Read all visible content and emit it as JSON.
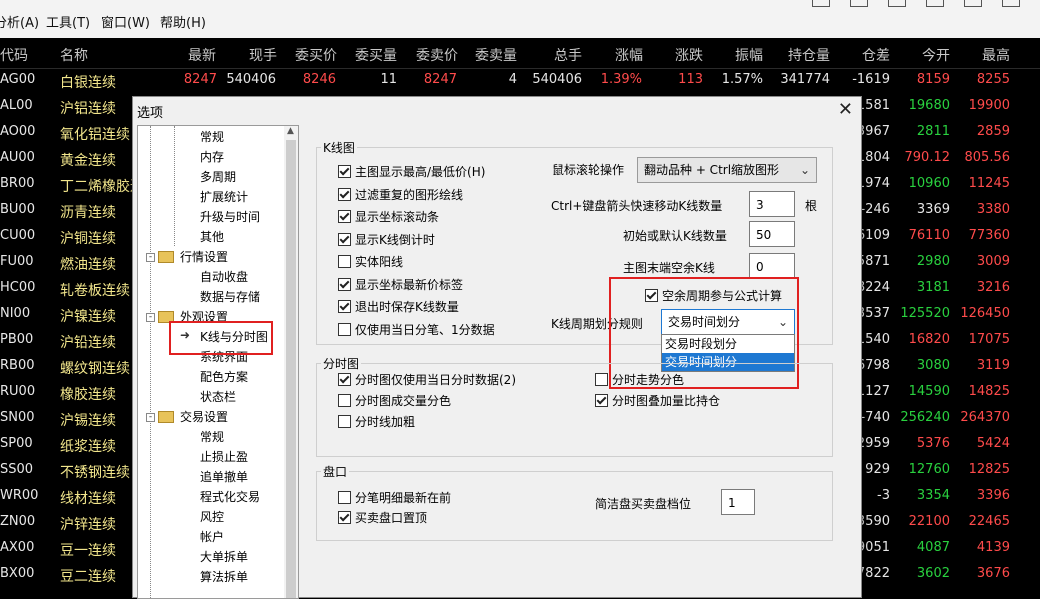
{
  "menu": [
    "分析(A)",
    "工具(T)",
    "窗口(W)",
    "帮助(H)"
  ],
  "columns": [
    "代码",
    "名称",
    "最新",
    "现手",
    "委买价",
    "委买量",
    "委卖价",
    "委卖量",
    "总手",
    "涨幅",
    "涨跌",
    "振幅",
    "持仓量",
    "仓差",
    "今开",
    "最高"
  ],
  "rows": [
    {
      "code": "AG00",
      "name": "白银连续",
      "c": [
        "8247",
        "540406",
        "8246",
        "11",
        "8247",
        "4",
        "540406",
        "1.39%",
        "113",
        "1.57%",
        "341774",
        "-1619",
        "8159",
        "8255"
      ],
      "k": [
        "red",
        "wht",
        "red",
        "wht",
        "red",
        "wht",
        "wht",
        "red",
        "red",
        "wht",
        "wht",
        "wht",
        "red",
        "red"
      ]
    },
    {
      "code": "AL00",
      "name": "沪铝连续",
      "c": [
        "",
        "",
        "",
        "",
        "",
        "",
        "",
        "",
        "",
        "",
        "",
        "1581",
        "19680",
        "19900"
      ],
      "k": [
        "",
        "",
        "",
        "",
        "",
        "",
        "",
        "",
        "",
        "",
        "",
        "wht",
        "grn",
        "red"
      ]
    },
    {
      "code": "AO00",
      "name": "氧化铝连续",
      "c": [
        "",
        "",
        "",
        "",
        "",
        "",
        "",
        "",
        "",
        "",
        "",
        "3967",
        "2811",
        "2859"
      ],
      "k": [
        "",
        "",
        "",
        "",
        "",
        "",
        "",
        "",
        "",
        "",
        "",
        "wht",
        "grn",
        "red"
      ]
    },
    {
      "code": "AU00",
      "name": "黄金连续",
      "c": [
        "",
        "",
        "",
        "",
        "",
        "",
        "",
        "",
        "",
        "",
        "",
        "1804",
        "790.12",
        "805.56"
      ],
      "k": [
        "",
        "",
        "",
        "",
        "",
        "",
        "",
        "",
        "",
        "",
        "",
        "wht",
        "red",
        "red"
      ]
    },
    {
      "code": "BR00",
      "name": "丁二烯橡胶连",
      "c": [
        "",
        "",
        "",
        "",
        "",
        "",
        "",
        "",
        "",
        "",
        "",
        "1974",
        "10960",
        "11245"
      ],
      "k": [
        "",
        "",
        "",
        "",
        "",
        "",
        "",
        "",
        "",
        "",
        "",
        "wht",
        "grn",
        "red"
      ]
    },
    {
      "code": "BU00",
      "name": "沥青连续",
      "c": [
        "",
        "",
        "",
        "",
        "",
        "",
        "",
        "",
        "",
        "",
        "",
        "-246",
        "3369",
        "3380"
      ],
      "k": [
        "",
        "",
        "",
        "",
        "",
        "",
        "",
        "",
        "",
        "",
        "",
        "wht",
        "wht",
        "red"
      ]
    },
    {
      "code": "CU00",
      "name": "沪铜连续",
      "c": [
        "",
        "",
        "",
        "",
        "",
        "",
        "",
        "",
        "",
        "",
        "",
        "6109",
        "76110",
        "77360"
      ],
      "k": [
        "",
        "",
        "",
        "",
        "",
        "",
        "",
        "",
        "",
        "",
        "",
        "wht",
        "red",
        "red"
      ]
    },
    {
      "code": "FU00",
      "name": "燃油连续",
      "c": [
        "",
        "",
        "",
        "",
        "",
        "",
        "",
        "",
        "",
        "",
        "",
        "5871",
        "2980",
        "3009"
      ],
      "k": [
        "",
        "",
        "",
        "",
        "",
        "",
        "",
        "",
        "",
        "",
        "",
        "wht",
        "grn",
        "red"
      ]
    },
    {
      "code": "HC00",
      "name": "轧卷板连续",
      "c": [
        "",
        "",
        "",
        "",
        "",
        "",
        "",
        "",
        "",
        "",
        "",
        "8224",
        "3181",
        "3216"
      ],
      "k": [
        "",
        "",
        "",
        "",
        "",
        "",
        "",
        "",
        "",
        "",
        "",
        "wht",
        "grn",
        "red"
      ]
    },
    {
      "code": "NI00",
      "name": "沪镍连续",
      "c": [
        "",
        "",
        "",
        "",
        "",
        "",
        "",
        "",
        "",
        "",
        "",
        "3537",
        "125520",
        "126450"
      ],
      "k": [
        "",
        "",
        "",
        "",
        "",
        "",
        "",
        "",
        "",
        "",
        "",
        "wht",
        "grn",
        "red"
      ]
    },
    {
      "code": "PB00",
      "name": "沪铅连续",
      "c": [
        "",
        "",
        "",
        "",
        "",
        "",
        "",
        "",
        "",
        "",
        "",
        "1540",
        "16820",
        "17075"
      ],
      "k": [
        "",
        "",
        "",
        "",
        "",
        "",
        "",
        "",
        "",
        "",
        "",
        "wht",
        "red",
        "red"
      ]
    },
    {
      "code": "RB00",
      "name": "螺纹钢连续",
      "c": [
        "",
        "",
        "",
        "",
        "",
        "",
        "",
        "",
        "",
        "",
        "",
        "6798",
        "3080",
        "3119"
      ],
      "k": [
        "",
        "",
        "",
        "",
        "",
        "",
        "",
        "",
        "",
        "",
        "",
        "wht",
        "grn",
        "red"
      ]
    },
    {
      "code": "RU00",
      "name": "橡胶连续",
      "c": [
        "",
        "",
        "",
        "",
        "",
        "",
        "",
        "",
        "",
        "",
        "",
        "1127",
        "14590",
        "14825"
      ],
      "k": [
        "",
        "",
        "",
        "",
        "",
        "",
        "",
        "",
        "",
        "",
        "",
        "wht",
        "grn",
        "red"
      ]
    },
    {
      "code": "SN00",
      "name": "沪锡连续",
      "c": [
        "",
        "",
        "",
        "",
        "",
        "",
        "",
        "",
        "",
        "",
        "",
        "-740",
        "256240",
        "264370"
      ],
      "k": [
        "",
        "",
        "",
        "",
        "",
        "",
        "",
        "",
        "",
        "",
        "",
        "wht",
        "grn",
        "red"
      ]
    },
    {
      "code": "SP00",
      "name": "纸浆连续",
      "c": [
        "",
        "",
        "",
        "",
        "",
        "",
        "",
        "",
        "",
        "",
        "",
        "2959",
        "5376",
        "5424"
      ],
      "k": [
        "",
        "",
        "",
        "",
        "",
        "",
        "",
        "",
        "",
        "",
        "",
        "wht",
        "red",
        "red"
      ]
    },
    {
      "code": "SS00",
      "name": "不锈钢连续",
      "c": [
        "",
        "",
        "",
        "",
        "",
        "",
        "",
        "",
        "",
        "",
        "",
        "929",
        "12760",
        "12825"
      ],
      "k": [
        "",
        "",
        "",
        "",
        "",
        "",
        "",
        "",
        "",
        "",
        "",
        "wht",
        "grn",
        "red"
      ]
    },
    {
      "code": "WR00",
      "name": "线材连续",
      "c": [
        "",
        "",
        "",
        "",
        "",
        "",
        "",
        "",
        "",
        "",
        "",
        "-3",
        "3354",
        "3396"
      ],
      "k": [
        "",
        "",
        "",
        "",
        "",
        "",
        "",
        "",
        "",
        "",
        "",
        "wht",
        "grn",
        "red"
      ]
    },
    {
      "code": "ZN00",
      "name": "沪锌连续",
      "c": [
        "",
        "",
        "",
        "",
        "",
        "",
        "",
        "",
        "",
        "",
        "",
        "3590",
        "22100",
        "22465"
      ],
      "k": [
        "",
        "",
        "",
        "",
        "",
        "",
        "",
        "",
        "",
        "",
        "",
        "wht",
        "red",
        "red"
      ]
    },
    {
      "code": "AX00",
      "name": "豆一连续",
      "c": [
        "",
        "",
        "",
        "",
        "",
        "",
        "",
        "",
        "",
        "",
        "",
        "9051",
        "4087",
        "4139"
      ],
      "k": [
        "",
        "",
        "",
        "",
        "",
        "",
        "",
        "",
        "",
        "",
        "",
        "wht",
        "grn",
        "red"
      ]
    },
    {
      "code": "BX00",
      "name": "豆二连续",
      "c": [
        "",
        "",
        "",
        "",
        "",
        "",
        "",
        "",
        "",
        "",
        "",
        "7822",
        "3602",
        "3676"
      ],
      "k": [
        "",
        "",
        "",
        "",
        "",
        "",
        "",
        "",
        "",
        "",
        "",
        "wht",
        "grn",
        "red"
      ]
    }
  ],
  "dialog": {
    "title": "选项",
    "close": "✕",
    "tree": {
      "general_children": [
        "常规",
        "内存",
        "多周期",
        "扩展统计",
        "升级与时间",
        "其他"
      ],
      "quote_settings": "行情设置",
      "quote_children": [
        "自动收盘",
        "数据与存储"
      ],
      "appearance": "外观设置",
      "appearance_children": [
        "K线与分时图",
        "系统界面",
        "配色方案",
        "状态栏"
      ],
      "trade_settings": "交易设置",
      "trade_children": [
        "常规",
        "止损止盈",
        "追单撤单",
        "程式化交易",
        "风控",
        "帐户",
        "大单拆单",
        "算法拆单"
      ]
    },
    "kline": {
      "group": "K线图",
      "checks": [
        {
          "label": "主图显示最高/最低价(H)",
          "on": true
        },
        {
          "label": "过滤重复的图形绘线",
          "on": true
        },
        {
          "label": "显示坐标滚动条",
          "on": true
        },
        {
          "label": "显示K线倒计时",
          "on": true
        },
        {
          "label": "实体阳线",
          "on": false
        },
        {
          "label": "显示坐标最新价标签",
          "on": true
        },
        {
          "label": "退出时保存K线数量",
          "on": true
        },
        {
          "label": "仅使用当日分笔、1分数据",
          "on": false
        }
      ],
      "wheel_label": "鼠标滚轮操作",
      "wheel_value": "翻动品种 + Ctrl缩放图形",
      "arrow_label": "Ctrl+键盘箭头快速移动K线数量",
      "arrow_value": "3",
      "arrow_unit": "根",
      "init_label": "初始或默认K线数量",
      "init_value": "50",
      "empty_label": "主图末端空余K线",
      "empty_value": "0",
      "empty_period": {
        "label": "空余周期参与公式计算",
        "on": true
      },
      "period_rule_label": "K线周期划分规则",
      "period_rule_value": "交易时间划分",
      "period_options": [
        "交易时段划分",
        "交易时间划分"
      ]
    },
    "intraday": {
      "group": "分时图",
      "checks": [
        {
          "label": "分时图仅使用当日分时数据(2)",
          "on": true
        },
        {
          "label": "分时图成交量分色",
          "on": false
        },
        {
          "label": "分时线加粗",
          "on": false
        }
      ],
      "trend_color": {
        "label": "分时走势分色",
        "on": false
      },
      "overlay_oi": {
        "label": "分时图叠加量比持仓",
        "on": true
      }
    },
    "depth": {
      "group": "盘口",
      "checks": [
        {
          "label": "分笔明细最新在前",
          "on": false
        },
        {
          "label": "买卖盘口置顶",
          "on": true
        }
      ],
      "levels_label": "简洁盘买卖盘档位",
      "levels_value": "1"
    }
  }
}
